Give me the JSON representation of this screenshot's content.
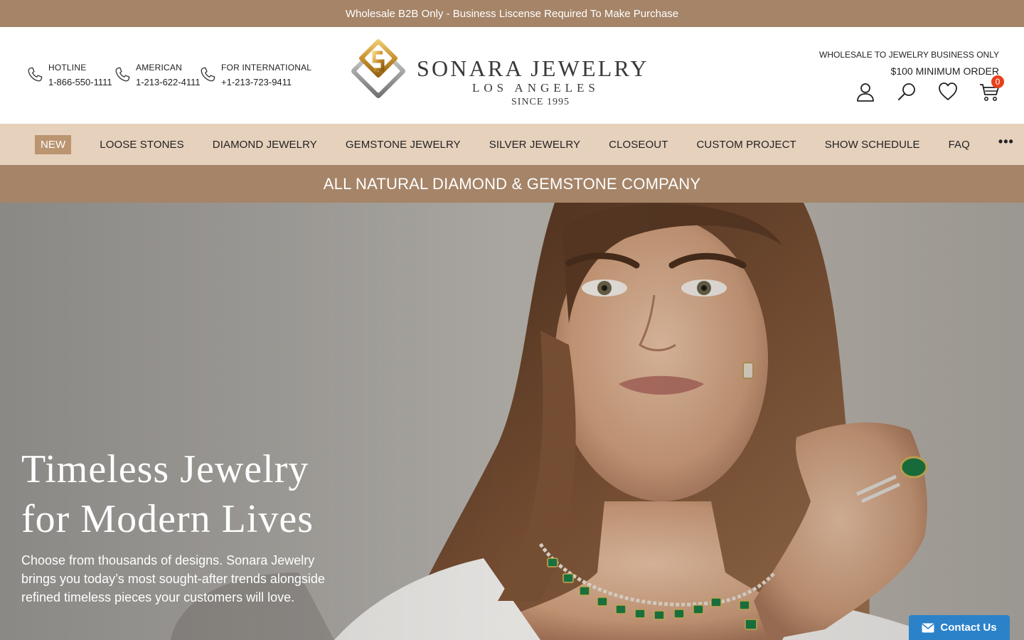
{
  "topbar": {
    "text": "Wholesale B2B Only - Business Liscense Required To Make Purchase"
  },
  "contacts": [
    {
      "label": "HOTLINE",
      "number": "1-866-550-1111"
    },
    {
      "label": "AMERICAN",
      "number": "1-213-622-4111"
    },
    {
      "label": "FOR INTERNATIONAL",
      "number": "+1-213-723-9411"
    }
  ],
  "logo": {
    "brand": "SONARA JEWELRY",
    "city": "LOS ANGELES",
    "since": "SINCE 1995"
  },
  "header_right": {
    "wholesale_note": "WHOLESALE TO JEWELRY BUSINESS ONLY",
    "minimum": "$100 MINIMUM ORDER",
    "cart_count": "0",
    "icons": [
      "account-icon",
      "search-icon",
      "heart-icon",
      "cart-icon"
    ]
  },
  "nav": {
    "items": [
      "NEW",
      "LOOSE STONES",
      "DIAMOND JEWELRY",
      "GEMSTONE JEWELRY",
      "SILVER JEWELRY",
      "CLOSEOUT",
      "CUSTOM PROJECT",
      "SHOW SCHEDULE",
      "FAQ"
    ],
    "more": "•••"
  },
  "tagline": "ALL NATURAL DIAMOND & GEMSTONE COMPANY",
  "hero": {
    "title_line1": "Timeless Jewelry",
    "title_line2": "for Modern Lives",
    "body": "Choose from thousands of designs. Sonara Jewelry brings you today’s most sought-after trends alongside refined timeless pieces your customers will love."
  },
  "contact_widget": {
    "label": "Contact Us"
  },
  "colors": {
    "brand_brown": "#a58468",
    "nav_bg": "#e6d1bd",
    "new_badge": "#bb9470",
    "cart_badge": "#e8401c",
    "contact_blue": "#2b82c9"
  }
}
